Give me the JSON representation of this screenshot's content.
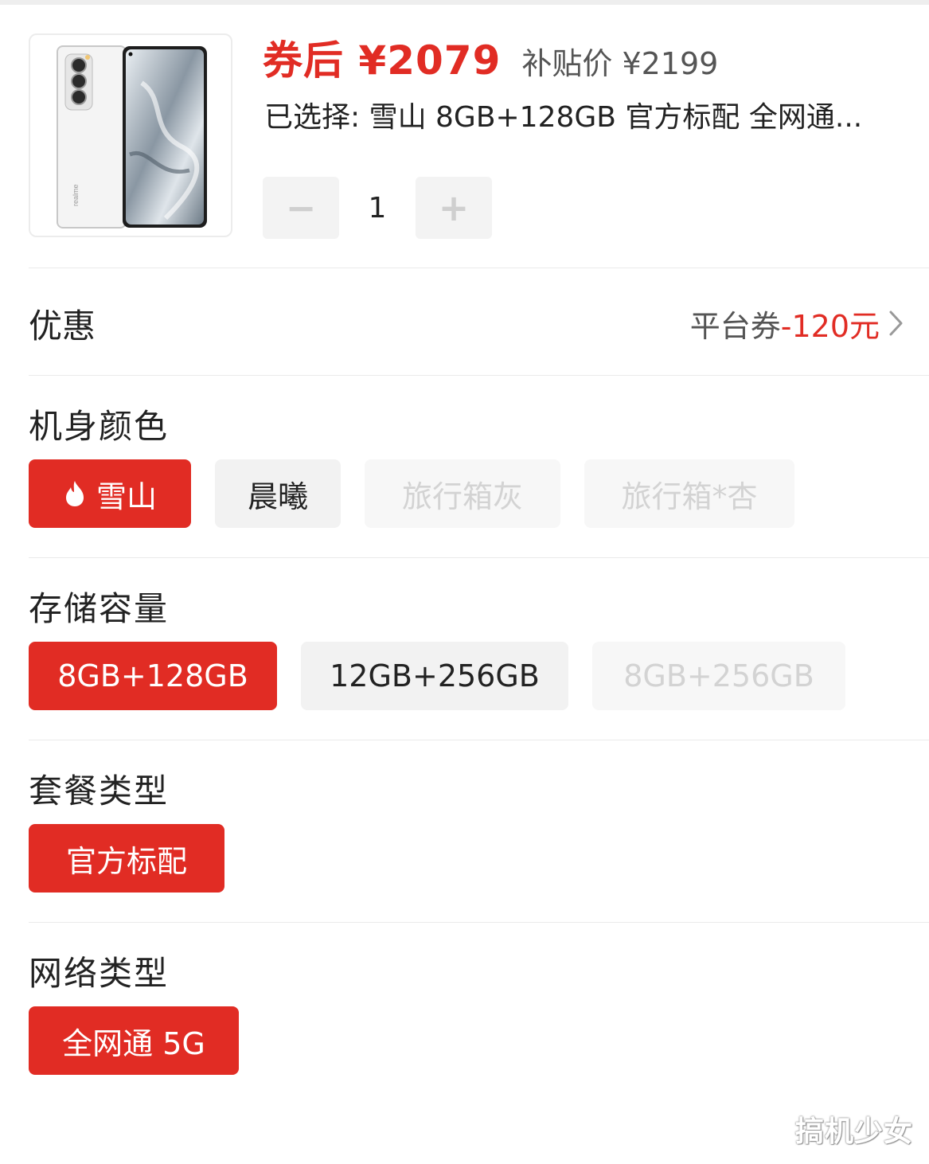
{
  "product": {
    "price_after_coupon": "券后 ¥2079",
    "subsidy_price": "补贴价 ¥2199",
    "selected_summary": "已选择: 雪山 8GB+128GB 官方标配 全网通...",
    "quantity": "1",
    "minus_symbol": "−",
    "plus_symbol": "+",
    "phone_brand_text": "realme"
  },
  "coupon": {
    "title": "优惠",
    "label": "平台券",
    "amount": "-120元",
    "icon": "chevron-right-icon"
  },
  "color_section": {
    "title": "机身颜色",
    "options": [
      {
        "label": "雪山",
        "state": "selected",
        "icon": "fire-icon"
      },
      {
        "label": "晨曦",
        "state": "normal"
      },
      {
        "label": "旅行箱灰",
        "state": "disabled"
      },
      {
        "label": "旅行箱*杏",
        "state": "disabled"
      }
    ]
  },
  "storage_section": {
    "title": "存储容量",
    "options": [
      {
        "label": "8GB+128GB",
        "state": "selected"
      },
      {
        "label": "12GB+256GB",
        "state": "normal"
      },
      {
        "label": "8GB+256GB",
        "state": "disabled"
      }
    ]
  },
  "package_section": {
    "title": "套餐类型",
    "options": [
      {
        "label": "官方标配",
        "state": "selected"
      }
    ]
  },
  "network_section": {
    "title": "网络类型",
    "options": [
      {
        "label": "全网通 5G",
        "state": "selected"
      }
    ]
  },
  "watermark": "搞机少女",
  "colors": {
    "accent": "#e12c24",
    "chip_normal_bg": "#f2f2f2",
    "chip_disabled_text": "#d3d3d3"
  }
}
